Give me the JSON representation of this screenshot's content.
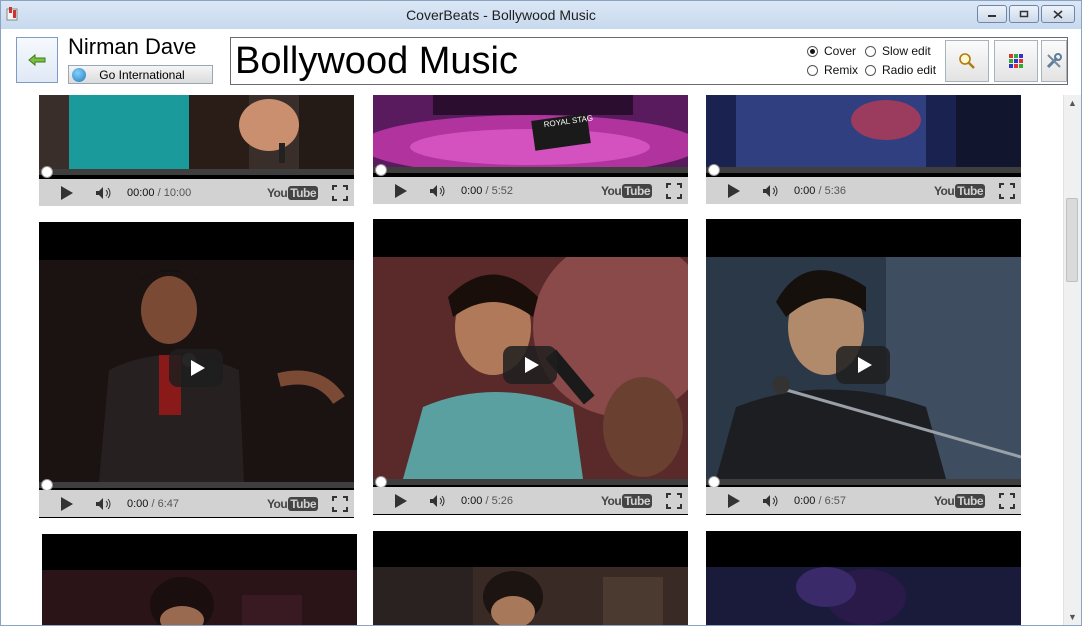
{
  "window": {
    "title": "CoverBeats - Bollywood Music",
    "minimize_icon": "minimize-icon",
    "maximize_icon": "maximize-icon",
    "close_icon": "close-icon"
  },
  "header": {
    "user_name": "Nirman Dave",
    "go_international_label": "Go International",
    "category_title": "Bollywood Music",
    "radio_options": [
      {
        "label": "Cover",
        "selected": true
      },
      {
        "label": "Slow edit",
        "selected": false
      },
      {
        "label": "Remix",
        "selected": false
      },
      {
        "label": "Radio edit",
        "selected": false
      }
    ],
    "icons": [
      "back-arrow-icon",
      "search-icon",
      "grid-icon",
      "tools-icon"
    ]
  },
  "videos": {
    "row1": [
      {
        "current": "00:00",
        "duration": "/ 10:00"
      },
      {
        "current": "0:00",
        "duration": "/ 5:52"
      },
      {
        "current": "0:00",
        "duration": "/ 5:36"
      }
    ],
    "row2": [
      {
        "current": "0:00",
        "duration": "/ 6:47"
      },
      {
        "current": "0:00",
        "duration": "/ 5:26"
      },
      {
        "current": "0:00",
        "duration": "/ 6:57"
      }
    ],
    "youtube_label_1": "You",
    "youtube_label_2": "Tube",
    "stage_sign": "ROYAL STAG"
  },
  "colors": {
    "titlebar": "#c7d9ee",
    "player_controls": "#d2d2d2",
    "accent_green": "#5aa02c"
  }
}
